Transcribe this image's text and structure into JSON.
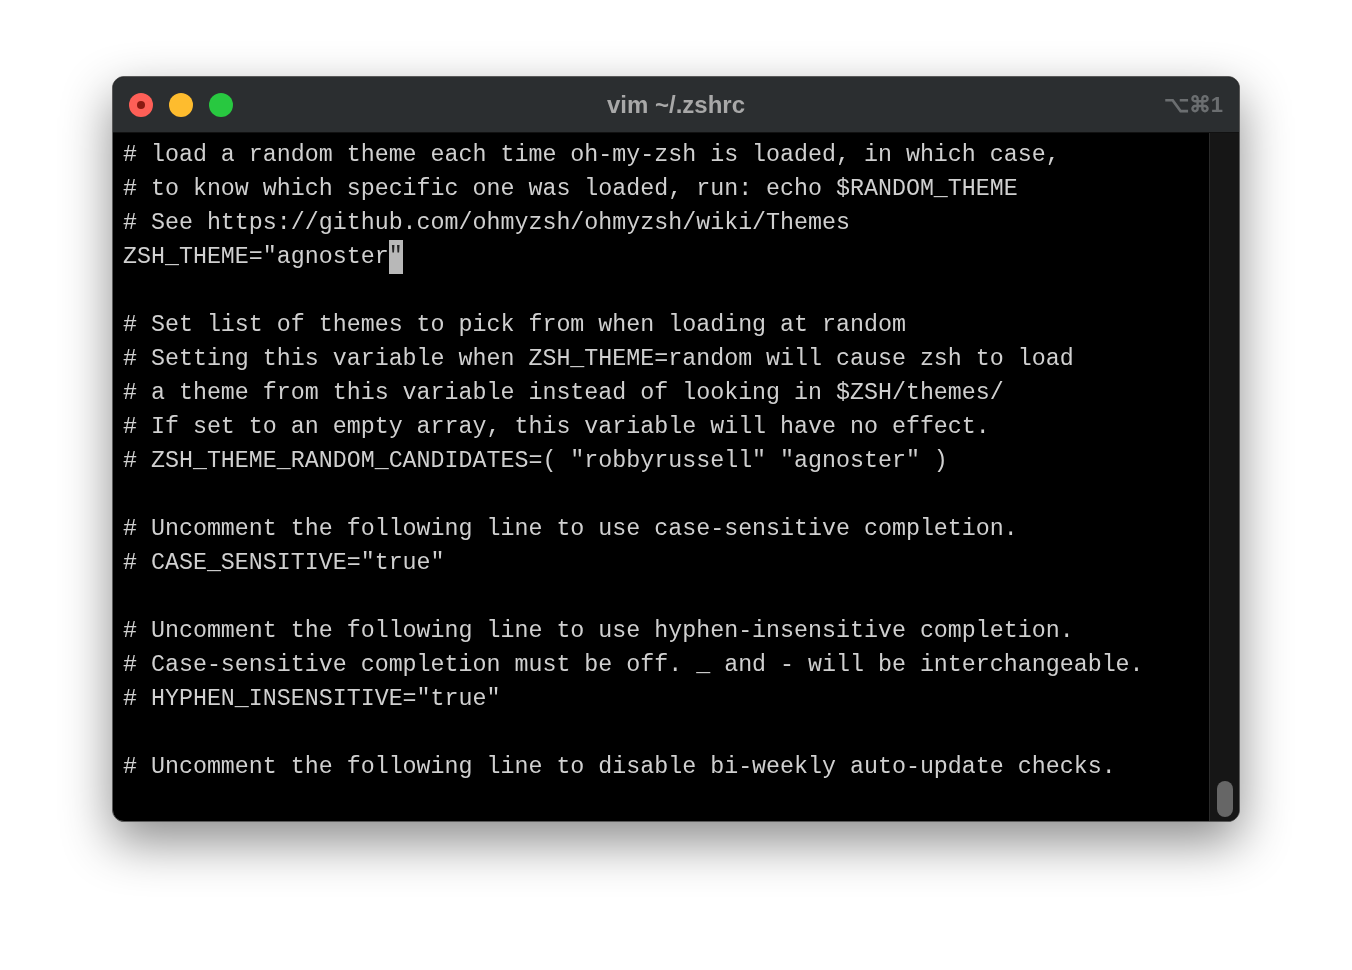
{
  "window": {
    "title": "vim ~/.zshrc",
    "shortcut": "⌥⌘1"
  },
  "lines": [
    {
      "kind": "text",
      "text": "# load a random theme each time oh-my-zsh is loaded, in which case,"
    },
    {
      "kind": "text",
      "text": "# to know which specific one was loaded, run: echo $RANDOM_THEME"
    },
    {
      "kind": "text",
      "text": "# See https://github.com/ohmyzsh/ohmyzsh/wiki/Themes"
    },
    {
      "kind": "text",
      "text": "ZSH_THEME=\"agnoster",
      "cursor": "\""
    },
    {
      "kind": "blank"
    },
    {
      "kind": "text",
      "text": "# Set list of themes to pick from when loading at random"
    },
    {
      "kind": "text",
      "text": "# Setting this variable when ZSH_THEME=random will cause zsh to load"
    },
    {
      "kind": "text",
      "text": "# a theme from this variable instead of looking in $ZSH/themes/"
    },
    {
      "kind": "text",
      "text": "# If set to an empty array, this variable will have no effect."
    },
    {
      "kind": "text",
      "text": "# ZSH_THEME_RANDOM_CANDIDATES=( \"robbyrussell\" \"agnoster\" )"
    },
    {
      "kind": "blank"
    },
    {
      "kind": "text",
      "text": "# Uncomment the following line to use case-sensitive completion."
    },
    {
      "kind": "text",
      "text": "# CASE_SENSITIVE=\"true\""
    },
    {
      "kind": "blank"
    },
    {
      "kind": "text",
      "text": "# Uncomment the following line to use hyphen-insensitive completion."
    },
    {
      "kind": "text",
      "text": "# Case-sensitive completion must be off. _ and - will be interchangeable."
    },
    {
      "kind": "text",
      "text": "# HYPHEN_INSENSITIVE=\"true\""
    },
    {
      "kind": "blank"
    },
    {
      "kind": "text",
      "text": "# Uncomment the following line to disable bi-weekly auto-update checks."
    }
  ]
}
